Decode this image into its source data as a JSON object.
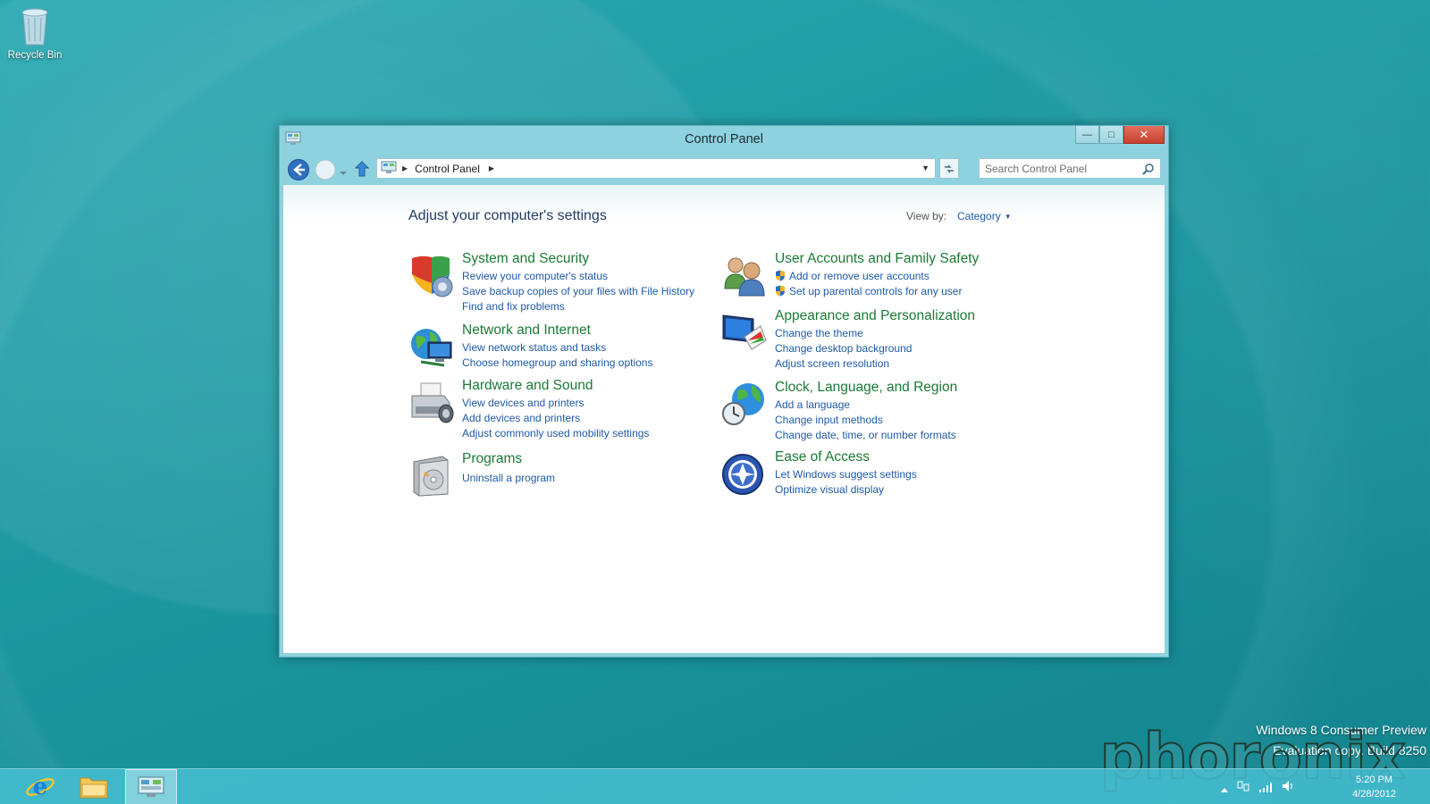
{
  "desktop": {
    "recycle_bin_label": "Recycle Bin"
  },
  "window": {
    "title": "Control Panel",
    "breadcrumb": "Control Panel",
    "search_placeholder": "Search Control Panel",
    "heading": "Adjust your computer's settings",
    "view_by_label": "View by:",
    "view_by_value": "Category",
    "categories": [
      {
        "title": "System and Security",
        "icon": "shield-icon",
        "links": [
          "Review your computer's status",
          "Save backup copies of your files with File History",
          "Find and fix problems"
        ]
      },
      {
        "title": "Network and Internet",
        "icon": "globe-network-icon",
        "links": [
          "View network status and tasks",
          "Choose homegroup and sharing options"
        ]
      },
      {
        "title": "Hardware and Sound",
        "icon": "printer-icon",
        "links": [
          "View devices and printers",
          "Add devices and printers",
          "Adjust commonly used mobility settings"
        ]
      },
      {
        "title": "Programs",
        "icon": "programs-icon",
        "links": [
          "Uninstall a program"
        ]
      },
      {
        "title": "User Accounts and Family Safety",
        "icon": "users-icon",
        "links": [
          "Add or remove user accounts",
          "Set up parental controls for any user"
        ]
      },
      {
        "title": "Appearance and Personalization",
        "icon": "monitor-icon",
        "links": [
          "Change the theme",
          "Change desktop background",
          "Adjust screen resolution"
        ]
      },
      {
        "title": "Clock, Language, and Region",
        "icon": "globe-clock-icon",
        "links": [
          "Add a language",
          "Change input methods",
          "Change date, time, or number formats"
        ]
      },
      {
        "title": "Ease of Access",
        "icon": "ease-of-access-icon",
        "links": [
          "Let Windows suggest settings",
          "Optimize visual display"
        ]
      }
    ]
  },
  "watermark": {
    "line1": "Windows 8 Consumer Preview",
    "line2": "Evaluation copy. Build 8250",
    "logo": "phoronix"
  },
  "clock": {
    "time": "5:20 PM",
    "date": "4/28/2012"
  },
  "colors": {
    "accent": "#1d9aa3",
    "link": "#1e5aa8",
    "category_title": "#1a7a35"
  }
}
